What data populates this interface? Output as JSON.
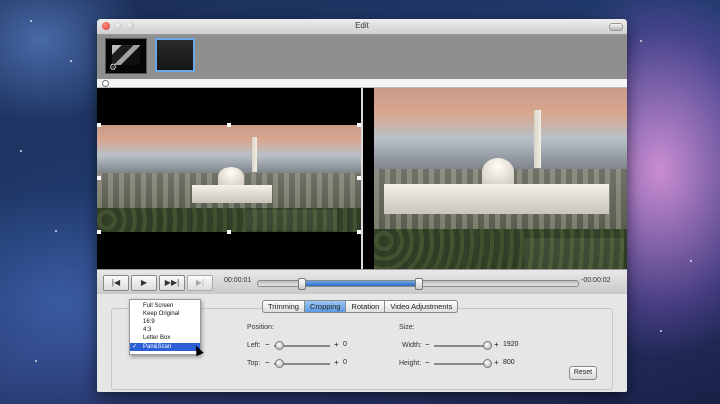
{
  "window": {
    "title": "Edit"
  },
  "thumbnails": [
    {
      "name": "clip-1"
    },
    {
      "name": "clip-2"
    }
  ],
  "playback": {
    "buttons": [
      "|◀",
      "▶",
      "▶▶|",
      "▶|"
    ],
    "current_time": "00:00:01",
    "end_time": "-00:00:02",
    "progress": 0.5
  },
  "tabs": [
    "Trimming",
    "Cropping",
    "Rotation",
    "Video Adjustments"
  ],
  "active_tab": "Cropping",
  "crop_mode_menu": {
    "items": [
      "Full Screen",
      "Keep Original",
      "16:9",
      "4:3",
      "Letter Box",
      "Pan&Scan"
    ],
    "selected": "Pan&Scan",
    "check": "✓"
  },
  "position": {
    "title": "Position:",
    "left": {
      "label": "Left:",
      "value": "0",
      "minus": "−",
      "plus": "+"
    },
    "top": {
      "label": "Top:",
      "value": "0",
      "minus": "−",
      "plus": "+"
    }
  },
  "size": {
    "title": "Size:",
    "width": {
      "label": "Width:",
      "value": "1920",
      "minus": "−",
      "plus": "+"
    },
    "height": {
      "label": "Height:",
      "value": "800",
      "minus": "−",
      "plus": "+"
    }
  },
  "reset_label": "Reset",
  "icons": {
    "close": "close-icon",
    "minimize": "minimize-icon",
    "zoom": "zoom-icon"
  }
}
